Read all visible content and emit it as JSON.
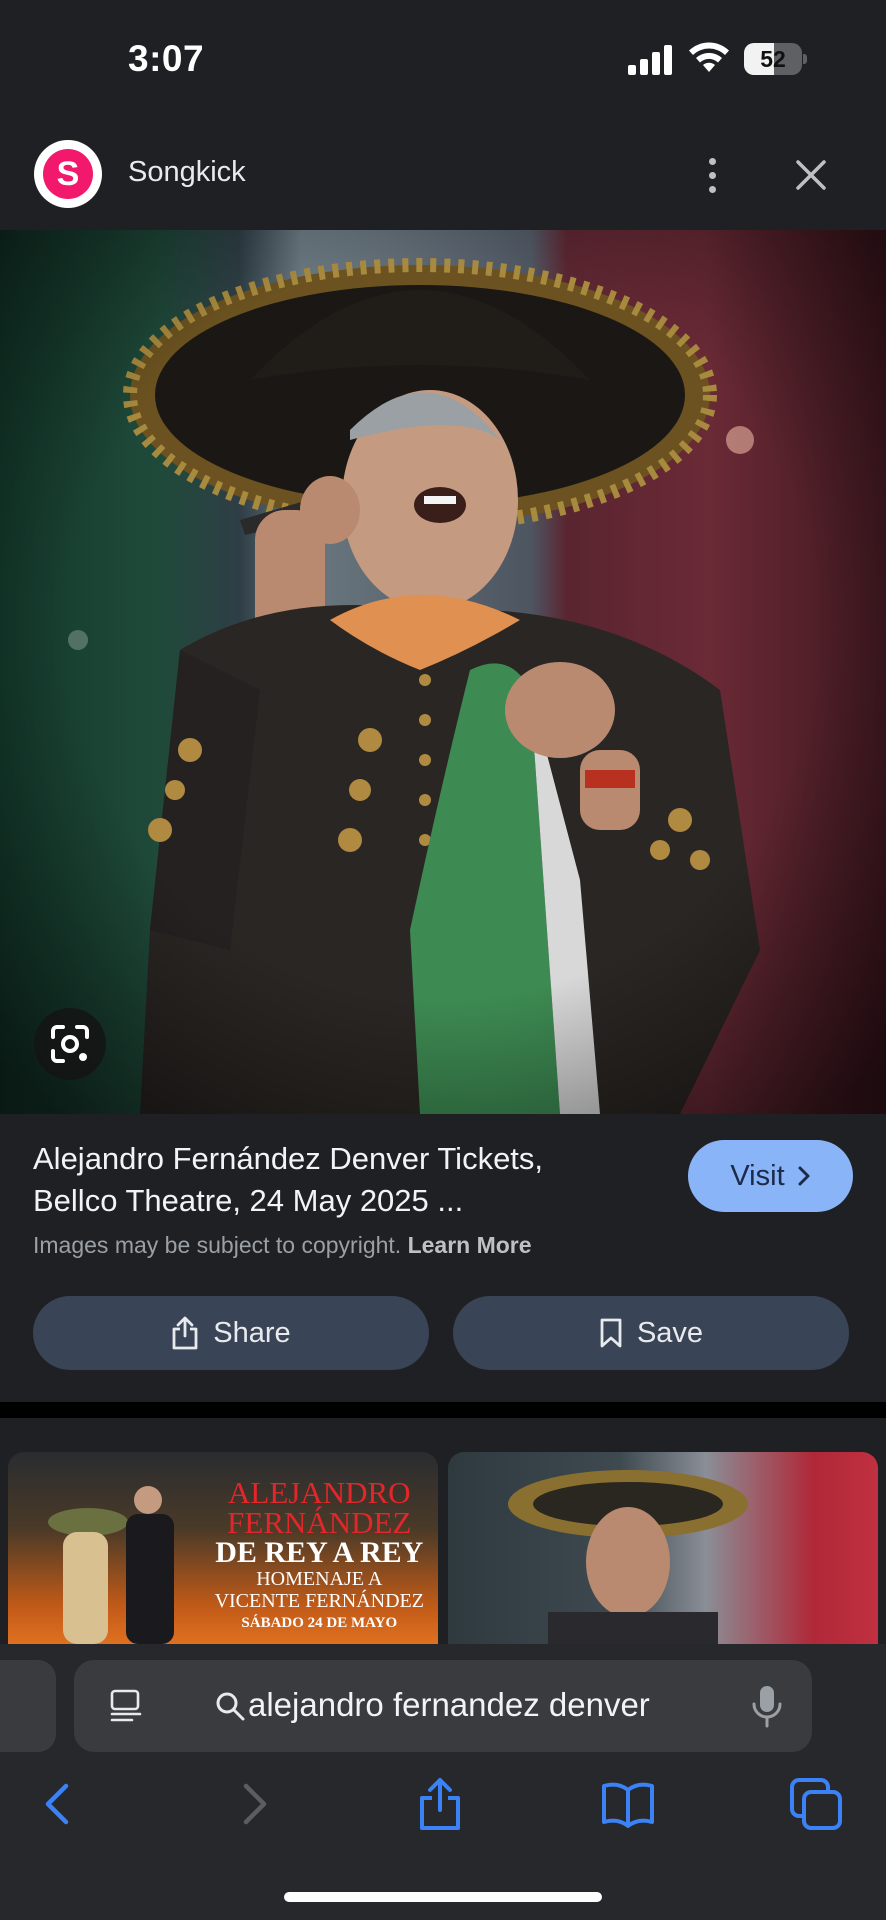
{
  "status_bar": {
    "time": "3:07",
    "battery": "52",
    "battery_level": 0.52
  },
  "header": {
    "site_name": "Songkick",
    "logo_letter": "S"
  },
  "result": {
    "title": "Alejandro Fernández Denver Tickets, Bellco Theatre, 24 May 2025 ...",
    "visit_label": "Visit",
    "copyright_text": "Images may be subject to copyright.",
    "learn_more": "Learn More",
    "share_label": "Share",
    "save_label": "Save"
  },
  "related": {
    "poster": {
      "line1": "ALEJANDRO",
      "line2": "FERNÁNDEZ",
      "line3": "DE REY A REY",
      "line4": "HOMENAJE A",
      "line5": "VICENTE FERNÁNDEZ",
      "line6": "SÁBADO 24 DE MAYO"
    }
  },
  "browser": {
    "address": "alejandro fernandez denver"
  },
  "icons": {
    "signal": "cellular-signal-icon",
    "wifi": "wifi-icon",
    "more": "more-vert-icon",
    "close": "close-icon",
    "lens": "google-lens-icon",
    "share": "share-icon",
    "save": "bookmark-icon",
    "reader": "reader-mode-icon",
    "mic": "microphone-icon",
    "back": "back-chevron-icon",
    "forward": "forward-chevron-icon",
    "browser_share": "share-icon",
    "bookmarks": "book-icon",
    "tabs": "tabs-icon"
  },
  "colors": {
    "accent": "#8ab4f8",
    "ios_blue": "#3b82f6",
    "songkick": "#f2196c",
    "button_bg": "#394457"
  }
}
